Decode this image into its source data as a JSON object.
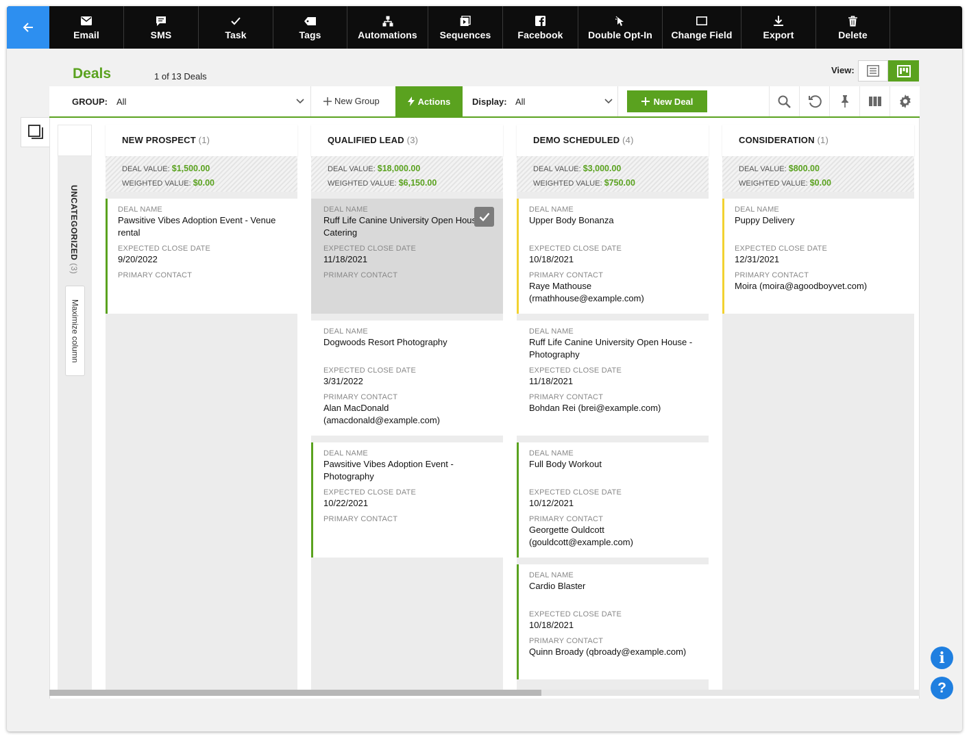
{
  "toolbar": {
    "back_icon": "arrow-left-icon",
    "buttons": [
      {
        "label": "Email",
        "icon": "envelope-icon"
      },
      {
        "label": "SMS",
        "icon": "chat-icon"
      },
      {
        "label": "Task",
        "icon": "checkmark-icon"
      },
      {
        "label": "Tags",
        "icon": "tag-icon"
      },
      {
        "label": "Automations",
        "icon": "flowchart-icon"
      },
      {
        "label": "Sequences",
        "icon": "sequence-icon"
      },
      {
        "label": "Facebook",
        "icon": "facebook-icon"
      },
      {
        "label": "Double Opt-In",
        "icon": "cursor-click-icon"
      },
      {
        "label": "Change Field",
        "icon": "field-box-icon"
      },
      {
        "label": "Export",
        "icon": "download-icon"
      },
      {
        "label": "Delete",
        "icon": "trash-icon"
      }
    ]
  },
  "header": {
    "title": "Deals",
    "count": "1 of 13 Deals",
    "view_label": "View:"
  },
  "filterbar": {
    "group_label": "GROUP:",
    "group_value": "All",
    "new_group": "New Group",
    "actions": "Actions",
    "display_label": "Display:",
    "display_value": "All",
    "new_deal": "New Deal"
  },
  "board": {
    "uncategorized": {
      "label": "UNCATEGORIZED",
      "count": "(3)"
    },
    "maximize": "Maximize column",
    "labels": {
      "deal_value": "DEAL VALUE:",
      "weighted_value": "WEIGHTED VALUE:",
      "deal_name": "DEAL NAME",
      "close_date": "EXPECTED CLOSE DATE",
      "primary_contact": "PRIMARY CONTACT"
    },
    "stages": [
      {
        "name": "NEW PROSPECT",
        "count": "(1)",
        "deal_value": "$1,500.00",
        "weighted_value": "$0.00",
        "cards": [
          {
            "name": "Pawsitive Vibes Adoption Event - Venue rental",
            "close_date": "9/20/2022",
            "contact": "",
            "bar": "#5aa21f",
            "selected": false
          }
        ]
      },
      {
        "name": "QUALIFIED LEAD",
        "count": "(3)",
        "deal_value": "$18,000.00",
        "weighted_value": "$6,150.00",
        "cards": [
          {
            "name": "Ruff Life Canine University Open House - Catering",
            "close_date": "11/18/2021",
            "contact": "",
            "bar": "",
            "selected": true
          },
          {
            "name": "Dogwoods Resort Photography",
            "close_date": "3/31/2022",
            "contact": "Alan MacDonald (amacdonald@example.com)",
            "bar": "",
            "selected": false
          },
          {
            "name": "Pawsitive Vibes Adoption Event - Photography",
            "close_date": "10/22/2021",
            "contact": "",
            "bar": "#5aa21f",
            "selected": false
          }
        ]
      },
      {
        "name": "DEMO SCHEDULED",
        "count": "(4)",
        "deal_value": "$3,000.00",
        "weighted_value": "$750.00",
        "cards": [
          {
            "name": "Upper Body Bonanza",
            "close_date": "10/18/2021",
            "contact": "Raye Mathouse (rmathhouse@example.com)",
            "bar": "#f2d230",
            "selected": false
          },
          {
            "name": "Ruff Life Canine University Open House - Photography",
            "close_date": "11/18/2021",
            "contact": "Bohdan Rei (brei@example.com)",
            "bar": "",
            "selected": false
          },
          {
            "name": "Full Body Workout",
            "close_date": "10/12/2021",
            "contact": "Georgette Ouldcott (gouldcott@example.com)",
            "bar": "#5aa21f",
            "selected": false
          },
          {
            "name": "Cardio Blaster",
            "close_date": "10/18/2021",
            "contact": "Quinn Broady (qbroady@example.com)",
            "bar": "#5aa21f",
            "selected": false
          }
        ]
      },
      {
        "name": "CONSIDERATION",
        "count": "(1)",
        "deal_value": "$800.00",
        "weighted_value": "$0.00",
        "cards": [
          {
            "name": "Puppy Delivery",
            "close_date": "12/31/2021",
            "contact": "Moira (moira@agoodboyvet.com)",
            "bar": "#f2d230",
            "selected": false
          }
        ]
      }
    ]
  },
  "help": {
    "info": "i",
    "question": "?"
  },
  "colors": {
    "accent": "#5aa21f",
    "back": "#2d8ff0",
    "toolbar": "#0d0d0d",
    "warning_bar": "#f2d230"
  }
}
